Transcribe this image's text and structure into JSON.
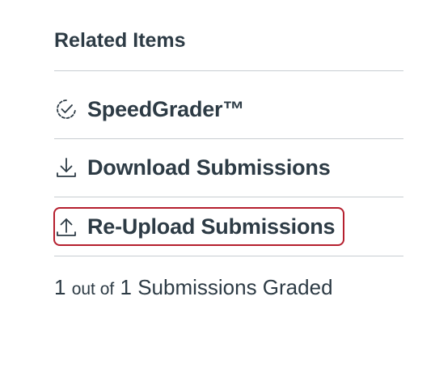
{
  "related": {
    "title": "Related Items",
    "items": [
      {
        "label": "SpeedGrader™",
        "icon": "speedgrader-icon"
      },
      {
        "label": "Download Submissions",
        "icon": "download-icon"
      },
      {
        "label": "Re-Upload Submissions",
        "icon": "upload-icon",
        "highlighted": true
      }
    ]
  },
  "graded_summary": {
    "count": "1",
    "out_of": "out of",
    "total": "1",
    "text": "Submissions Graded"
  },
  "colors": {
    "text": "#2d3b45",
    "divider": "#c7cdd1",
    "highlight_border": "#b51f2e"
  }
}
